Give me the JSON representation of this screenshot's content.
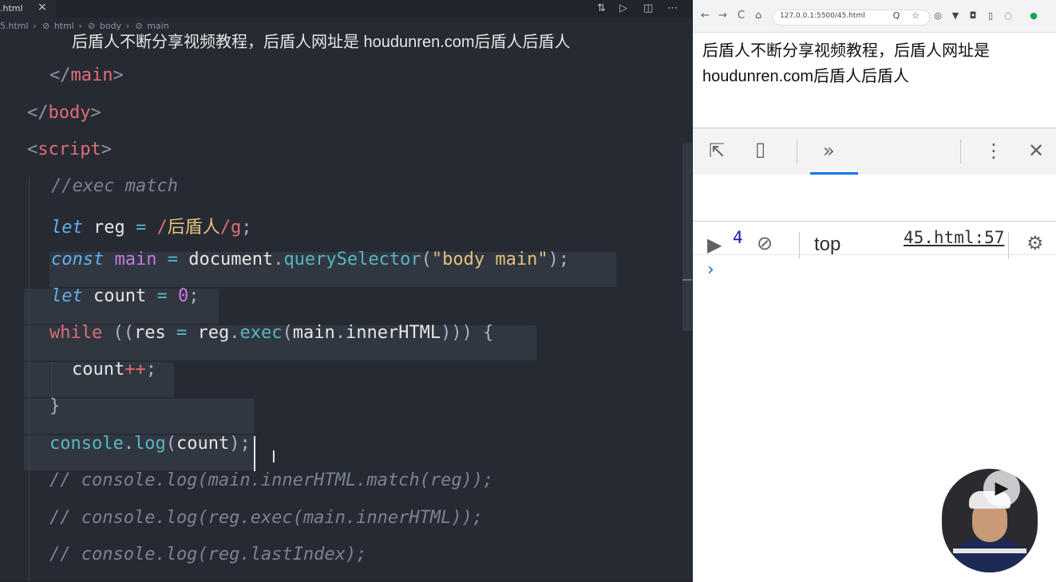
{
  "editor": {
    "tab": {
      "name": ".html",
      "close": "×"
    },
    "tab_actions": [
      "⇅",
      "▷",
      "◫",
      "⋯"
    ],
    "breadcrumb": [
      "5.html",
      "html",
      "body",
      "main"
    ],
    "lines": {
      "l1_text": "后盾人不断分享视频教程，后盾人网址是 houdunren.com后盾人后盾人",
      "l2": [
        "</",
        "main",
        ">"
      ],
      "l3": [
        "</",
        "body",
        ">"
      ],
      "l4": [
        "<",
        "script",
        ">"
      ],
      "l5": "//exec match",
      "l6": {
        "kw": "let",
        "name": "reg",
        "eq": "=",
        "rx_open": "/",
        "rx_text": "后盾人",
        "rx_close": "/g",
        "end": ";"
      },
      "l7": {
        "kw": "const",
        "name": "main",
        "eq": "=",
        "obj": "document",
        "dot": ".",
        "method": "querySelector",
        "open": "(",
        "str": "\"body main\"",
        "close": ");"
      },
      "l8": {
        "kw": "let",
        "name": "count",
        "eq": "=",
        "num": "0",
        "end": ";"
      },
      "l9": {
        "kw": "while",
        "open": " ((",
        "a": "res",
        "eq": "=",
        "b": "reg",
        "dot": ".",
        "method": "exec",
        "p1": "(",
        "c": "main",
        "dot2": ".",
        "d": "innerHTML",
        "close": "))) {"
      },
      "l10": {
        "name": "count",
        "op": "++",
        "end": ";"
      },
      "l11": "}",
      "l12": {
        "obj": "console",
        "dot": ".",
        "method": "log",
        "open": "(",
        "arg": "count",
        "close": ")",
        "end": ";"
      },
      "l13": "// console.log(main.innerHTML.match(reg));",
      "l14": "// console.log(reg.exec(main.innerHTML));",
      "l15": "// console.log(reg.lastIndex);"
    }
  },
  "browser": {
    "nav": [
      "←",
      "→",
      "C",
      "⌂"
    ],
    "url": "127.0.0.1:5500/45.html",
    "extensions": [
      "Q",
      "☆",
      "◎",
      "▼",
      "◘",
      "▯",
      "◌",
      "●"
    ],
    "page_text": "后盾人不断分享视频教程，后盾人网址是 houdunren.com后盾人后盾人",
    "devtools": {
      "tools": [
        "⇱",
        "▯",
        "»",
        "⋮",
        "✕"
      ],
      "console_tools": [
        "▶",
        "⊘",
        "⚙"
      ],
      "context": "top",
      "log_value": "4",
      "log_source": "45.html:57",
      "prompt": "›"
    }
  },
  "webcam": {
    "play": "▶"
  },
  "colors": {
    "editor_bg": "#262b33",
    "tag": "#e06c75",
    "keyword": "#61afef",
    "function": "#56b6c2",
    "string": "#e5c07b",
    "console_number": "#1a1aa6",
    "devtools_accent": "#1a73e8"
  }
}
